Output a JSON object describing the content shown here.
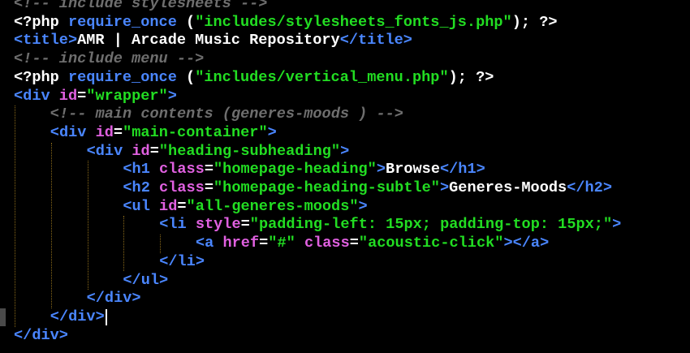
{
  "editor": {
    "lines": [
      {
        "indent": 0,
        "tokens": [
          {
            "c": "cmt",
            "t": "<!-- include stylesheets -->"
          }
        ]
      },
      {
        "indent": 0,
        "tokens": [
          {
            "c": "def",
            "t": "<?php "
          },
          {
            "c": "kw",
            "t": "require_once "
          },
          {
            "c": "par",
            "t": "("
          },
          {
            "c": "str",
            "t": "\"includes/stylesheets_fonts_js.php\""
          },
          {
            "c": "par",
            "t": "); ?>"
          }
        ]
      },
      {
        "indent": 0,
        "tokens": [
          {
            "c": "tag",
            "t": "<title>"
          },
          {
            "c": "def",
            "t": "AMR | Arcade Music Repository"
          },
          {
            "c": "tag",
            "t": "</title>"
          }
        ]
      },
      {
        "indent": 0,
        "tokens": [
          {
            "c": "cmt",
            "t": "<!-- include menu -->"
          }
        ]
      },
      {
        "indent": 0,
        "tokens": [
          {
            "c": "def",
            "t": "<?php "
          },
          {
            "c": "kw",
            "t": "require_once "
          },
          {
            "c": "par",
            "t": "("
          },
          {
            "c": "str",
            "t": "\"includes/vertical_menu.php\""
          },
          {
            "c": "par",
            "t": "); ?>"
          }
        ]
      },
      {
        "indent": 0,
        "tokens": [
          {
            "c": "tag",
            "t": "<div "
          },
          {
            "c": "att",
            "t": "id"
          },
          {
            "c": "op",
            "t": "="
          },
          {
            "c": "str",
            "t": "\"wrapper\""
          },
          {
            "c": "tag",
            "t": ">"
          }
        ]
      },
      {
        "indent": 1,
        "tokens": [
          {
            "c": "cmt",
            "t": "<!-- main contents (generes-moods ) -->"
          }
        ]
      },
      {
        "indent": 1,
        "tokens": [
          {
            "c": "tag",
            "t": "<div "
          },
          {
            "c": "att",
            "t": "id"
          },
          {
            "c": "op",
            "t": "="
          },
          {
            "c": "str",
            "t": "\"main-container\""
          },
          {
            "c": "tag",
            "t": ">"
          }
        ]
      },
      {
        "indent": 2,
        "tokens": [
          {
            "c": "tag",
            "t": "<div "
          },
          {
            "c": "att",
            "t": "id"
          },
          {
            "c": "op",
            "t": "="
          },
          {
            "c": "str",
            "t": "\"heading-subheading\""
          },
          {
            "c": "tag",
            "t": ">"
          }
        ]
      },
      {
        "indent": 3,
        "tokens": [
          {
            "c": "tag",
            "t": "<h1 "
          },
          {
            "c": "att",
            "t": "class"
          },
          {
            "c": "op",
            "t": "="
          },
          {
            "c": "str",
            "t": "\"homepage-heading\""
          },
          {
            "c": "tag",
            "t": ">"
          },
          {
            "c": "def",
            "t": "Browse"
          },
          {
            "c": "tag",
            "t": "</h1>"
          }
        ]
      },
      {
        "indent": 3,
        "tokens": [
          {
            "c": "tag",
            "t": "<h2 "
          },
          {
            "c": "att",
            "t": "class"
          },
          {
            "c": "op",
            "t": "="
          },
          {
            "c": "str",
            "t": "\"homepage-heading-subtle\""
          },
          {
            "c": "tag",
            "t": ">"
          },
          {
            "c": "def",
            "t": "Generes-Moods"
          },
          {
            "c": "tag",
            "t": "</h2>"
          }
        ]
      },
      {
        "indent": 3,
        "tokens": [
          {
            "c": "tag",
            "t": "<ul "
          },
          {
            "c": "att",
            "t": "id"
          },
          {
            "c": "op",
            "t": "="
          },
          {
            "c": "str",
            "t": "\"all-generes-moods\""
          },
          {
            "c": "tag",
            "t": ">"
          }
        ]
      },
      {
        "indent": 4,
        "tokens": [
          {
            "c": "tag",
            "t": "<li "
          },
          {
            "c": "att",
            "t": "style"
          },
          {
            "c": "op",
            "t": "="
          },
          {
            "c": "str",
            "t": "\"padding-left: 15px; padding-top: 15px;\""
          },
          {
            "c": "tag",
            "t": ">"
          }
        ]
      },
      {
        "indent": 5,
        "tokens": [
          {
            "c": "tag",
            "t": "<a "
          },
          {
            "c": "att",
            "t": "href"
          },
          {
            "c": "op",
            "t": "="
          },
          {
            "c": "str",
            "t": "\"#\" "
          },
          {
            "c": "att",
            "t": "class"
          },
          {
            "c": "op",
            "t": "="
          },
          {
            "c": "str",
            "t": "\"acoustic-click\""
          },
          {
            "c": "tag",
            "t": "></a>"
          }
        ]
      },
      {
        "indent": 4,
        "tokens": [
          {
            "c": "tag",
            "t": "</li>"
          }
        ]
      },
      {
        "indent": 3,
        "tokens": [
          {
            "c": "tag",
            "t": "</ul>"
          }
        ]
      },
      {
        "indent": 2,
        "tokens": [
          {
            "c": "tag",
            "t": "</div>"
          }
        ]
      },
      {
        "indent": 1,
        "tokens": [
          {
            "c": "tag",
            "t": "</div>"
          }
        ]
      },
      {
        "indent": 0,
        "tokens": [
          {
            "c": "tag",
            "t": "</div>"
          }
        ]
      }
    ],
    "colors": {
      "background": "#000000",
      "comment": "#6e6e6e",
      "keyword": "#4a86ff",
      "tag": "#4a86ff",
      "attribute": "#e060e0",
      "string": "#22dd22",
      "plain": "#ffffff",
      "indent_guide": "#8a6a1a"
    }
  }
}
